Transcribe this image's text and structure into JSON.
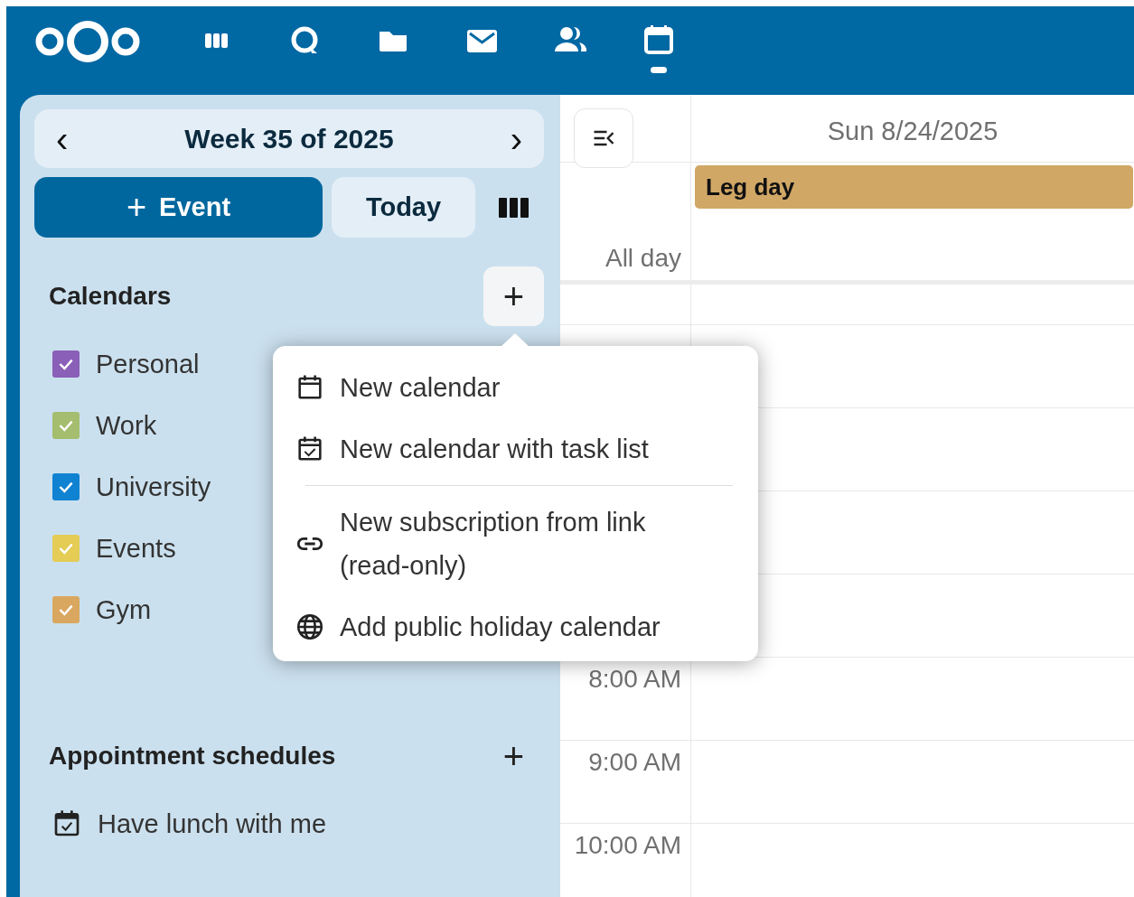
{
  "header": {
    "apps": [
      {
        "kind": "dashboard",
        "selected": false
      },
      {
        "kind": "talk",
        "selected": false
      },
      {
        "kind": "files",
        "selected": false
      },
      {
        "kind": "mail",
        "selected": false
      },
      {
        "kind": "contacts",
        "selected": false
      },
      {
        "kind": "calendar",
        "selected": true
      }
    ]
  },
  "sidebar": {
    "period": {
      "prev": "‹",
      "label": "Week 35 of 2025",
      "next": "›"
    },
    "new_event": {
      "icon": "+",
      "label": "Event"
    },
    "today": "Today",
    "calendars": {
      "title": "Calendars",
      "add": "+",
      "items": [
        {
          "name": "Personal",
          "checked": true,
          "color": "#8a5fb8"
        },
        {
          "name": "Work",
          "checked": true,
          "color": "#a4bd6e"
        },
        {
          "name": "University",
          "checked": true,
          "color": "#0f82d2"
        },
        {
          "name": "Events",
          "checked": true,
          "color": "#e4cc55"
        },
        {
          "name": "Gym",
          "checked": true,
          "color": "#d9a75f"
        }
      ]
    },
    "appointments": {
      "title": "Appointment schedules",
      "add": "+",
      "items": [
        {
          "name": "Have lunch with me"
        }
      ]
    }
  },
  "add_menu": {
    "items": [
      {
        "kind": "calendar",
        "label": "New calendar"
      },
      {
        "kind": "tasks",
        "label": "New calendar with task list"
      },
      {
        "kind": "separator"
      },
      {
        "kind": "link",
        "label": "New subscription from link (read-only)"
      },
      {
        "kind": "globe",
        "label": "Add public holiday calendar"
      }
    ]
  },
  "day_view": {
    "date": "Sun 8/24/2025",
    "all_day_label": "All day",
    "all_day_events": [
      {
        "title": "Leg day",
        "color": "#d1a766"
      }
    ],
    "hour_rows": [
      {},
      {},
      {},
      {},
      {},
      {
        "label": "8:00 AM"
      },
      {
        "label": "9:00 AM"
      },
      {
        "label": "10:00 AM"
      }
    ]
  }
}
